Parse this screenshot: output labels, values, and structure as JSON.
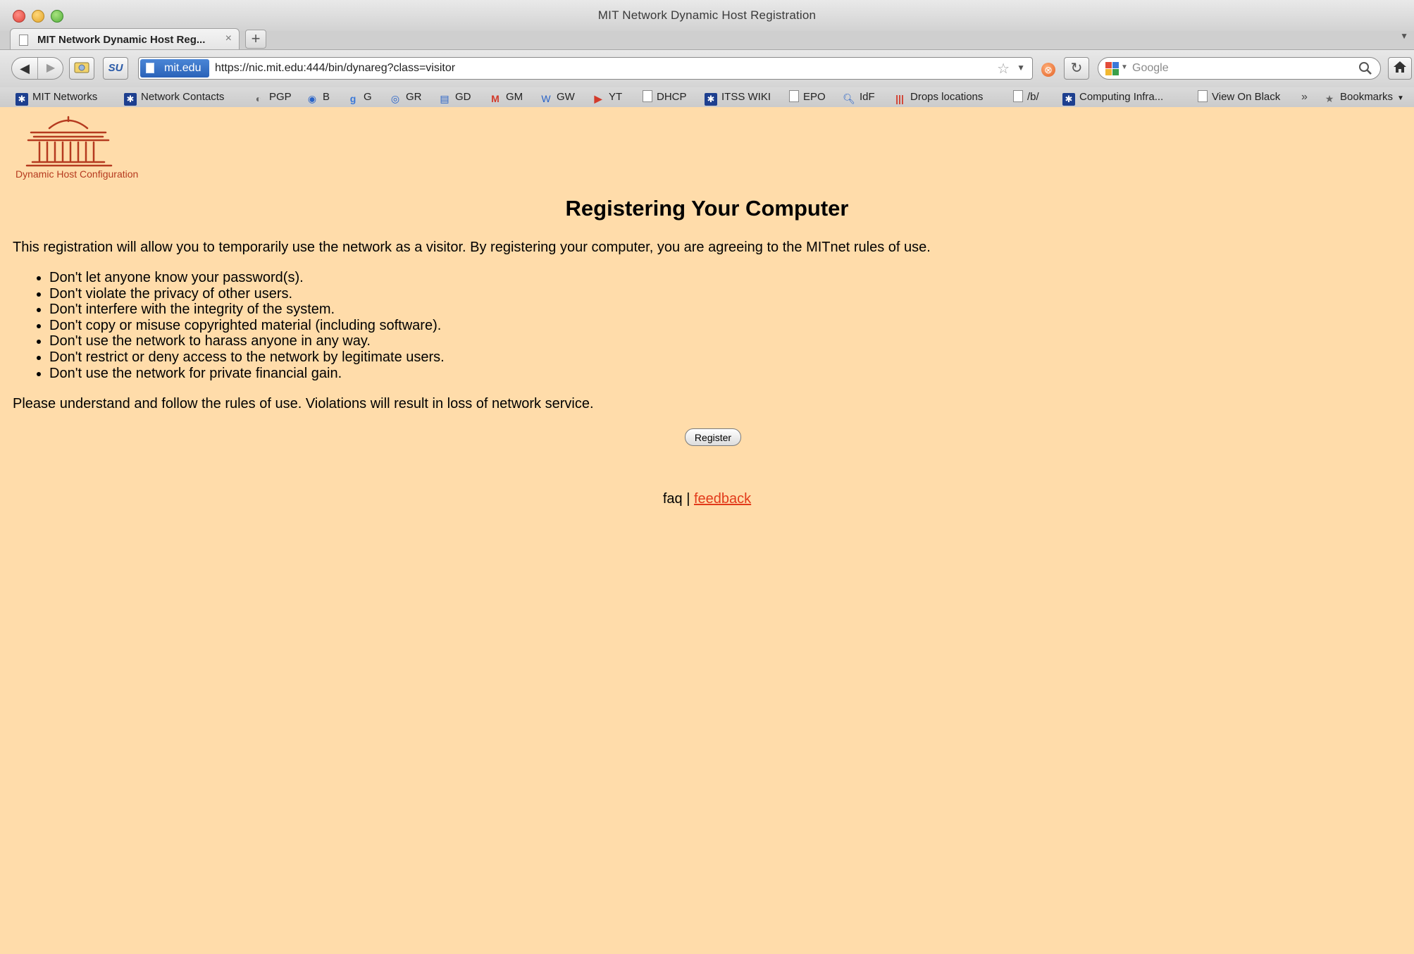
{
  "window": {
    "title": "MIT Network Dynamic Host Registration"
  },
  "tab": {
    "title": "MIT Network Dynamic Host Reg...",
    "close_glyph": "×",
    "new_tab_glyph": "+"
  },
  "navbar": {
    "identity_label": "mit.edu",
    "url": "https://nic.mit.edu:444/bin/dynareg?class=visitor",
    "search_placeholder": "Google",
    "stumble_label": "SU"
  },
  "bookmarks": [
    {
      "label": "MIT Networks",
      "icon": "mit-icon"
    },
    {
      "label": "Network Contacts",
      "icon": "mit-icon"
    },
    {
      "label": "PGP",
      "icon": "pgp-icon"
    },
    {
      "label": "B",
      "icon": "eye-icon"
    },
    {
      "label": "G",
      "icon": "google-icon"
    },
    {
      "label": "GR",
      "icon": "reader-icon"
    },
    {
      "label": "GD",
      "icon": "docs-icon"
    },
    {
      "label": "GM",
      "icon": "gmail-icon"
    },
    {
      "label": "GW",
      "icon": "wave-icon"
    },
    {
      "label": "YT",
      "icon": "youtube-icon"
    },
    {
      "label": "DHCP",
      "icon": "page-icon"
    },
    {
      "label": "ITSS WIKI",
      "icon": "mit-icon"
    },
    {
      "label": "EPO",
      "icon": "page-icon"
    },
    {
      "label": "IdF",
      "icon": "search-doc-icon"
    },
    {
      "label": "Drops locations",
      "icon": "bars-icon"
    },
    {
      "label": "/b/",
      "icon": "page-icon"
    },
    {
      "label": "Computing Infra...",
      "icon": "mit-icon"
    },
    {
      "label": "View On Black",
      "icon": "page-icon"
    },
    {
      "label": "Bookmarks",
      "icon": "bookmarks-icon"
    }
  ],
  "bookmarks_overflow": "»",
  "page": {
    "logo_caption": "Dynamic Host Configuration",
    "heading": "Registering Your Computer",
    "intro": "This registration will allow you to temporarily use the network as a visitor. By registering your computer, you are agreeing to the MITnet rules of use.",
    "rules": [
      "Don't let anyone know your password(s).",
      "Don't violate the privacy of other users.",
      "Don't interfere with the integrity of the system.",
      "Don't copy or misuse copyrighted material (including software).",
      "Don't use the network to harass anyone in any way.",
      "Don't restrict or deny access to the network by legitimate users.",
      "Don't use the network for private financial gain."
    ],
    "warning": "Please understand and follow the rules of use. Violations will result in loss of network service.",
    "register_label": "Register",
    "footer": {
      "faq": "faq",
      "separator": "|",
      "feedback": "feedback"
    }
  },
  "colors": {
    "page_background": "#ffdcaa",
    "link": "#e23a1a",
    "logo": "#b53a1f"
  }
}
